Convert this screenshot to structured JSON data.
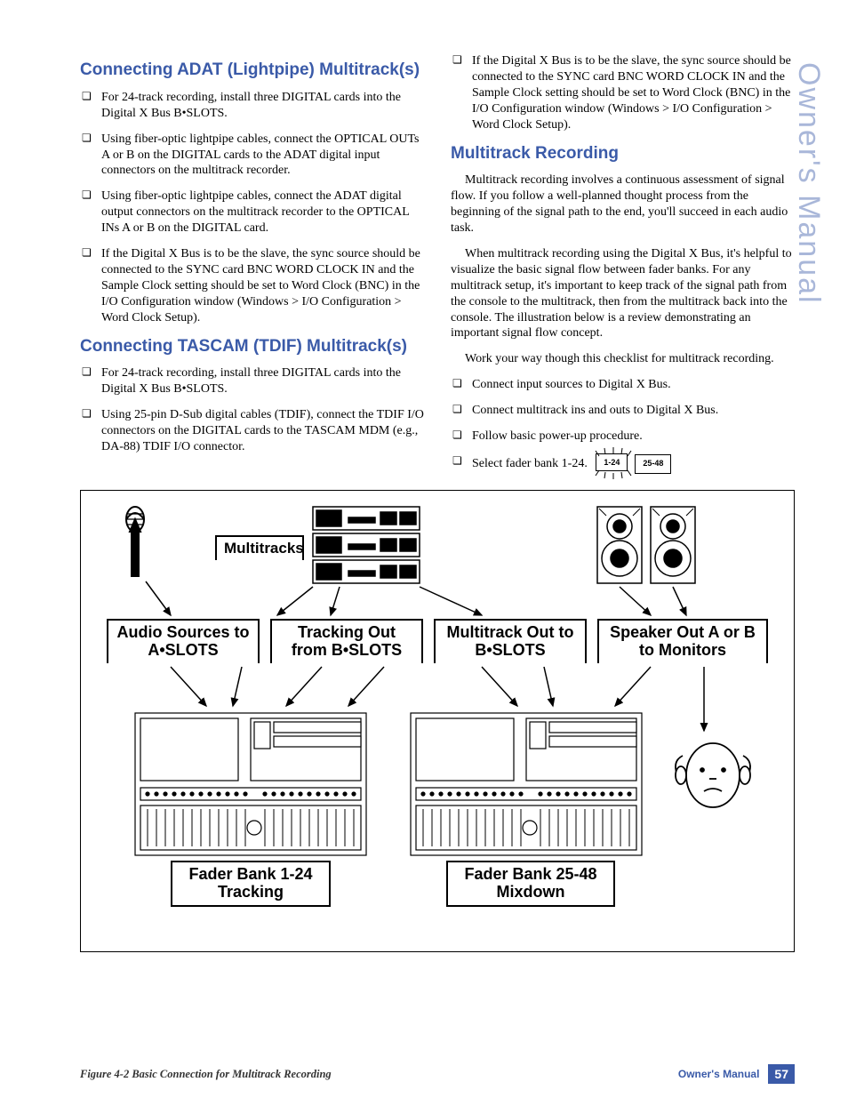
{
  "side_label": "Owner's Manual",
  "col1": {
    "h1": "Connecting ADAT (Lightpipe) Multitrack(s)",
    "b1": [
      "For 24-track recording, install three DIGITAL cards into the Digital X Bus B•SLOTS.",
      "Using fiber-optic lightpipe cables, connect the OPTICAL OUTs A or B on the DIGITAL cards to the ADAT digital input connectors on the multitrack recorder.",
      "Using fiber-optic lightpipe cables, connect the ADAT digital output connectors on the multitrack recorder to the OPTICAL INs A or B on the DIGITAL card.",
      "If the Digital X Bus is to be the slave, the sync source should be connected to the SYNC card BNC WORD CLOCK IN and the Sample Clock setting should be set to Word Clock (BNC) in the I/O Configuration window (Windows > I/O Configuration > Word Clock Setup)."
    ],
    "h2": "Connecting TASCAM (TDIF) Multitrack(s)",
    "b2": [
      "For 24-track recording, install three DIGITAL cards into the Digital X Bus B•SLOTS.",
      "Using 25-pin D-Sub digital cables (TDIF), connect the TDIF I/O connectors on the DIGITAL cards to the TASCAM MDM (e.g., DA-88) TDIF I/O connector."
    ]
  },
  "col2": {
    "b0": [
      "If the Digital X Bus is to be the slave, the sync source should be connected to the SYNC card BNC WORD CLOCK IN and the Sample Clock setting should be set to Word Clock (BNC) in the I/O Configuration window (Windows > I/O Configuration > Word Clock Setup)."
    ],
    "h1": "Multitrack Recording",
    "p1": "Multitrack recording involves a continuous assessment of signal flow. If you follow a well-planned thought process from the beginning of the signal path to the end, you'll succeed in each audio task.",
    "p2": "When multitrack recording using the Digital X Bus, it's helpful to visualize the basic signal flow between fader banks. For any multitrack setup, it's important to keep track of the signal path from the console to the multitrack, then from the multitrack back into the console. The illustration below is a review demonstrating an important signal flow concept.",
    "p3": "Work your way though this checklist for multitrack recording.",
    "b1": [
      "Connect input sources to Digital X Bus.",
      "Connect multitrack ins and outs to Digital X Bus.",
      "Follow basic power-up procedure.",
      "Select fader bank 1-24."
    ],
    "btn1": "1-24",
    "btn2": "25-48"
  },
  "figure": {
    "multitracks": "Multitracks",
    "row": [
      "Audio Sources to A•SLOTS",
      "Tracking Out from B•SLOTS",
      "Multitrack Out to B•SLOTS",
      "Speaker Out A or B to Monitors"
    ],
    "bank1": "Fader Bank 1-24 Tracking",
    "bank2": "Fader Bank 25-48 Mixdown"
  },
  "caption": "Figure 4-2  Basic Connection for Multitrack Recording",
  "footer_label": "Owner's Manual",
  "page_number": "57"
}
